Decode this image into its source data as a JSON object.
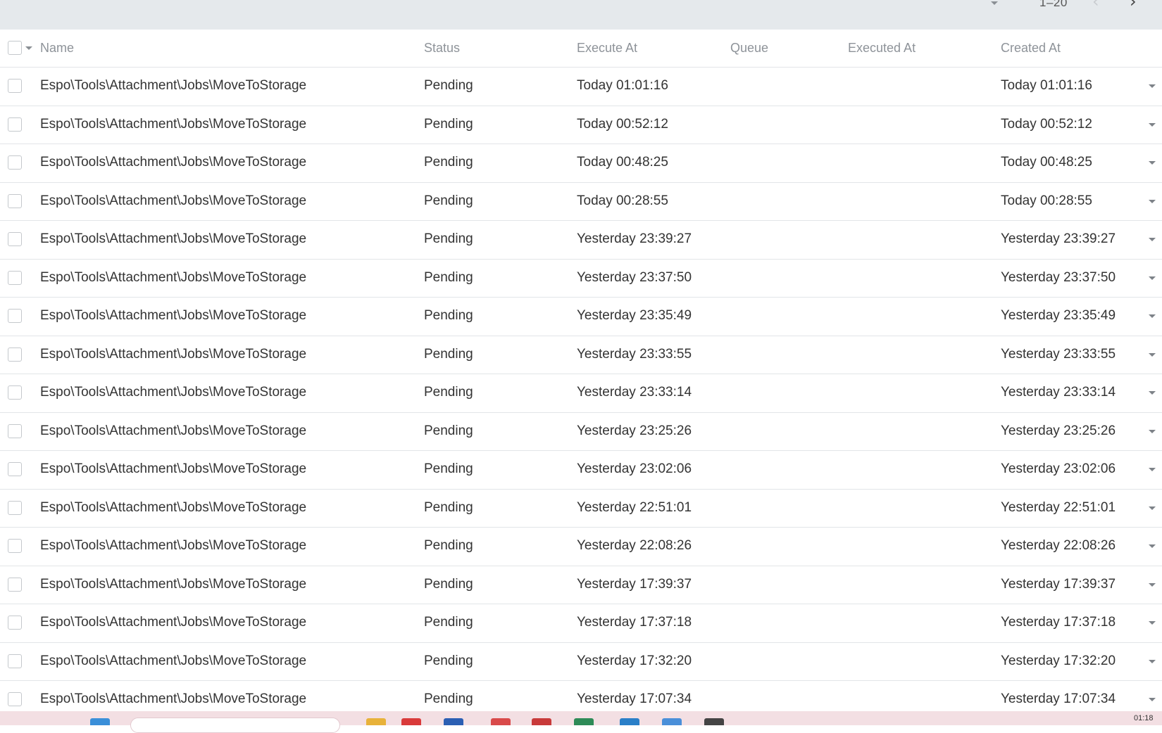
{
  "pagination": {
    "range": "1–20",
    "prev_icon": "chevron-left-icon",
    "next_icon": "chevron-right-icon"
  },
  "table": {
    "columns": {
      "name": "Name",
      "status": "Status",
      "execute_at": "Execute At",
      "queue": "Queue",
      "executed_at": "Executed At",
      "created_at": "Created At"
    },
    "rows": [
      {
        "name": "Espo\\Tools\\Attachment\\Jobs\\MoveToStorage",
        "status": "Pending",
        "execute_at": "Today 01:01:16",
        "queue": "",
        "executed_at": "",
        "created_at": "Today 01:01:16"
      },
      {
        "name": "Espo\\Tools\\Attachment\\Jobs\\MoveToStorage",
        "status": "Pending",
        "execute_at": "Today 00:52:12",
        "queue": "",
        "executed_at": "",
        "created_at": "Today 00:52:12"
      },
      {
        "name": "Espo\\Tools\\Attachment\\Jobs\\MoveToStorage",
        "status": "Pending",
        "execute_at": "Today 00:48:25",
        "queue": "",
        "executed_at": "",
        "created_at": "Today 00:48:25"
      },
      {
        "name": "Espo\\Tools\\Attachment\\Jobs\\MoveToStorage",
        "status": "Pending",
        "execute_at": "Today 00:28:55",
        "queue": "",
        "executed_at": "",
        "created_at": "Today 00:28:55"
      },
      {
        "name": "Espo\\Tools\\Attachment\\Jobs\\MoveToStorage",
        "status": "Pending",
        "execute_at": "Yesterday 23:39:27",
        "queue": "",
        "executed_at": "",
        "created_at": "Yesterday 23:39:27"
      },
      {
        "name": "Espo\\Tools\\Attachment\\Jobs\\MoveToStorage",
        "status": "Pending",
        "execute_at": "Yesterday 23:37:50",
        "queue": "",
        "executed_at": "",
        "created_at": "Yesterday 23:37:50"
      },
      {
        "name": "Espo\\Tools\\Attachment\\Jobs\\MoveToStorage",
        "status": "Pending",
        "execute_at": "Yesterday 23:35:49",
        "queue": "",
        "executed_at": "",
        "created_at": "Yesterday 23:35:49"
      },
      {
        "name": "Espo\\Tools\\Attachment\\Jobs\\MoveToStorage",
        "status": "Pending",
        "execute_at": "Yesterday 23:33:55",
        "queue": "",
        "executed_at": "",
        "created_at": "Yesterday 23:33:55"
      },
      {
        "name": "Espo\\Tools\\Attachment\\Jobs\\MoveToStorage",
        "status": "Pending",
        "execute_at": "Yesterday 23:33:14",
        "queue": "",
        "executed_at": "",
        "created_at": "Yesterday 23:33:14"
      },
      {
        "name": "Espo\\Tools\\Attachment\\Jobs\\MoveToStorage",
        "status": "Pending",
        "execute_at": "Yesterday 23:25:26",
        "queue": "",
        "executed_at": "",
        "created_at": "Yesterday 23:25:26"
      },
      {
        "name": "Espo\\Tools\\Attachment\\Jobs\\MoveToStorage",
        "status": "Pending",
        "execute_at": "Yesterday 23:02:06",
        "queue": "",
        "executed_at": "",
        "created_at": "Yesterday 23:02:06"
      },
      {
        "name": "Espo\\Tools\\Attachment\\Jobs\\MoveToStorage",
        "status": "Pending",
        "execute_at": "Yesterday 22:51:01",
        "queue": "",
        "executed_at": "",
        "created_at": "Yesterday 22:51:01"
      },
      {
        "name": "Espo\\Tools\\Attachment\\Jobs\\MoveToStorage",
        "status": "Pending",
        "execute_at": "Yesterday 22:08:26",
        "queue": "",
        "executed_at": "",
        "created_at": "Yesterday 22:08:26"
      },
      {
        "name": "Espo\\Tools\\Attachment\\Jobs\\MoveToStorage",
        "status": "Pending",
        "execute_at": "Yesterday 17:39:37",
        "queue": "",
        "executed_at": "",
        "created_at": "Yesterday 17:39:37"
      },
      {
        "name": "Espo\\Tools\\Attachment\\Jobs\\MoveToStorage",
        "status": "Pending",
        "execute_at": "Yesterday 17:37:18",
        "queue": "",
        "executed_at": "",
        "created_at": "Yesterday 17:37:18"
      },
      {
        "name": "Espo\\Tools\\Attachment\\Jobs\\MoveToStorage",
        "status": "Pending",
        "execute_at": "Yesterday 17:32:20",
        "queue": "",
        "executed_at": "",
        "created_at": "Yesterday 17:32:20"
      },
      {
        "name": "Espo\\Tools\\Attachment\\Jobs\\MoveToStorage",
        "status": "Pending",
        "execute_at": "Yesterday 17:07:34",
        "queue": "",
        "executed_at": "",
        "created_at": "Yesterday 17:07:34"
      }
    ]
  },
  "taskbar": {
    "app_icons": [
      {
        "icon": "windows-start-icon",
        "color": "#3a8fd9"
      },
      {
        "icon": "file-explorer-icon",
        "color": "#e8b23a"
      },
      {
        "icon": "chrome-icon",
        "color": "#d93a3a"
      },
      {
        "icon": "word-icon",
        "color": "#2b5fb3"
      },
      {
        "icon": "app-icon",
        "color": "#d94a4a"
      },
      {
        "icon": "calendar-icon",
        "color": "#c83a3a"
      },
      {
        "icon": "excel-icon",
        "color": "#2e8b57"
      },
      {
        "icon": "app-icon",
        "color": "#2a7fc8"
      },
      {
        "icon": "app-icon",
        "color": "#4a8fd9"
      },
      {
        "icon": "terminal-icon",
        "color": "#444444"
      }
    ],
    "clock": "01:18"
  },
  "colors": {
    "topbar_bg": "#e5e9ec",
    "header_text": "#8e9399",
    "row_text": "#333333",
    "divider": "#e2e5e8",
    "taskbar_bg": "#f3dfe3"
  }
}
